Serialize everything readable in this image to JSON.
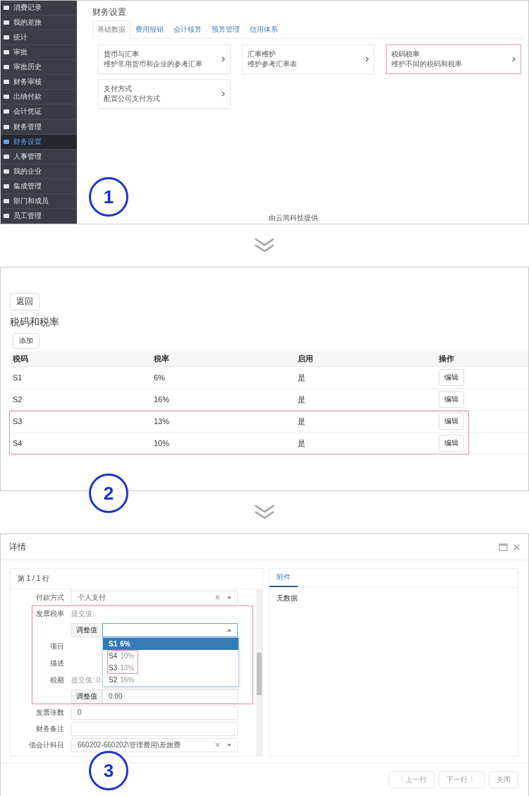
{
  "panel1": {
    "sidebar": [
      {
        "label": "消费记录",
        "selected": false
      },
      {
        "label": "我的差旅",
        "selected": false
      },
      {
        "label": "统计",
        "selected": false
      },
      {
        "label": "审批",
        "selected": false
      },
      {
        "label": "审批历史",
        "selected": false
      },
      {
        "label": "财务审核",
        "selected": false
      },
      {
        "label": "出纳付款",
        "selected": false
      },
      {
        "label": "会计凭证",
        "selected": false
      },
      {
        "label": "财务管理",
        "selected": false
      },
      {
        "label": "财务设置",
        "selected": true
      },
      {
        "label": "人事管理",
        "selected": false
      },
      {
        "label": "我的企业",
        "selected": false
      },
      {
        "label": "集成管理",
        "selected": false
      },
      {
        "label": "部门和成员",
        "selected": false
      },
      {
        "label": "员工管理",
        "selected": false
      }
    ],
    "title": "财务设置",
    "tabs": [
      {
        "label": "基础数据",
        "selected": true
      },
      {
        "label": "费用报销",
        "selected": false
      },
      {
        "label": "会计核算",
        "selected": false
      },
      {
        "label": "预算管理",
        "selected": false
      },
      {
        "label": "信用体系",
        "selected": false
      }
    ],
    "cards": [
      {
        "title": "货币与汇率",
        "description": "维护常用货币和企业的参考汇率",
        "highlighted": false
      },
      {
        "title": "汇率维护",
        "description": "维护参考汇率表",
        "highlighted": false
      },
      {
        "title": "税码税率",
        "description": "维护不同的税码和税率",
        "highlighted": true
      },
      {
        "title": "支付方式",
        "description": "配置公司支付方式",
        "highlighted": false
      }
    ],
    "footer": "由云简科技提供",
    "step": "1"
  },
  "panel2": {
    "back": "返回",
    "title": "税码和税率",
    "add": "添加",
    "columns": [
      "税码",
      "税率",
      "启用",
      "操作"
    ],
    "rows": [
      {
        "code": "S1",
        "rate": "6%",
        "enabled": "是",
        "action": "编辑"
      },
      {
        "code": "S2",
        "rate": "16%",
        "enabled": "是",
        "action": "编辑"
      },
      {
        "code": "S3",
        "rate": "13%",
        "enabled": "是",
        "action": "编辑",
        "highlighted": true
      },
      {
        "code": "S4",
        "rate": "10%",
        "enabled": "是",
        "action": "编辑",
        "highlighted": true
      }
    ],
    "step": "2"
  },
  "panel3": {
    "title": "详情",
    "row_counter": "第 1 / 1 行",
    "fields": [
      {
        "label": "付款方式",
        "kind": "select",
        "value": "个人支付"
      },
      {
        "label": "发票税率",
        "kind": "adjust",
        "submitted": "提交值:",
        "adjust": "调整值",
        "open": true,
        "highlighted": true,
        "options": [
          {
            "code": "S1",
            "rate": "6%",
            "selected": true
          },
          {
            "code": "S4",
            "rate": "10%",
            "selected": false,
            "highlighted": true
          },
          {
            "code": "S3",
            "rate": "13%",
            "selected": false,
            "highlighted": true
          },
          {
            "code": "S2",
            "rate": "16%",
            "selected": false
          }
        ]
      },
      {
        "label": "项目",
        "kind": "plain",
        "highlighted": true
      },
      {
        "label": "描述",
        "kind": "plain",
        "highlighted": true
      },
      {
        "label": "税额",
        "kind": "adjust",
        "submitted": "提交值: 0.",
        "adjust": "调整值",
        "value": "0.00",
        "open": false,
        "highlighted": true
      },
      {
        "label": "发票张数",
        "kind": "text",
        "value": "0"
      },
      {
        "label": "财务备注",
        "kind": "text"
      },
      {
        "label": "借会计科目",
        "kind": "select",
        "value": "660202-660202\\管理费用\\差旅费"
      }
    ],
    "attachments_tab": "附件",
    "empty": "无数据",
    "buttons": [
      "〈 上一行",
      "下一行 〉",
      "关闭"
    ],
    "step": "3"
  }
}
